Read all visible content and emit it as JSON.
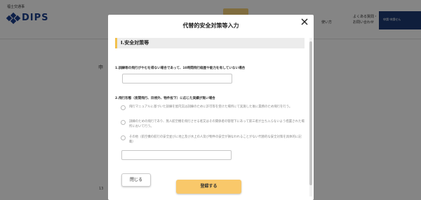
{
  "background": {
    "tagline": "福士交通事",
    "logo_text": "DIPS",
    "nav_item_1": "使い方",
    "nav_item_2_line1": "よくある質問・",
    "nav_item_2_line2": "お問い合わせ",
    "nav_dark_text": "申請    申請せん",
    "side_number_1": "申",
    "side_number_2": "13"
  },
  "modal": {
    "title": "代替的安全対策等入力",
    "section_heading": "Ⅰ.安全対策等",
    "question1_label": "1.訓練等の飛行がやむを得ない場合であって、10時間飛行経歴や能力を有していない場合",
    "question1_input_value": "",
    "question2_label": "2.飛行形態（夜間飛行、目視外、物件投下）に応じた実績が無い場合",
    "options": [
      {
        "label": "飛行マニュアルに基づいた訓練を屋内又は訓練のために許可等を受けた場所にて実施した後に業務のため飛行を行う。"
      },
      {
        "label": "訓練のための飛行であり、無人航空機を飛行させる者又はその関係者の管理下にあって第三者が立ち入らないよう措置された場所において行う。"
      },
      {
        "label": "その他（航空機の航行の安全並びに地上及び水上の人及び物件の安全が損なわれることがない代替的な安全対策を具体的に記載）"
      }
    ],
    "other_input_value": "",
    "close_button_label": "閉じる",
    "register_button_label": "登録する"
  },
  "colors": {
    "accent_yellow": "#f9c86a",
    "heading_bar": "#f2c14e",
    "brand_blue": "#1a3e8c",
    "overlay": "rgba(0,0,0,0.48)"
  }
}
